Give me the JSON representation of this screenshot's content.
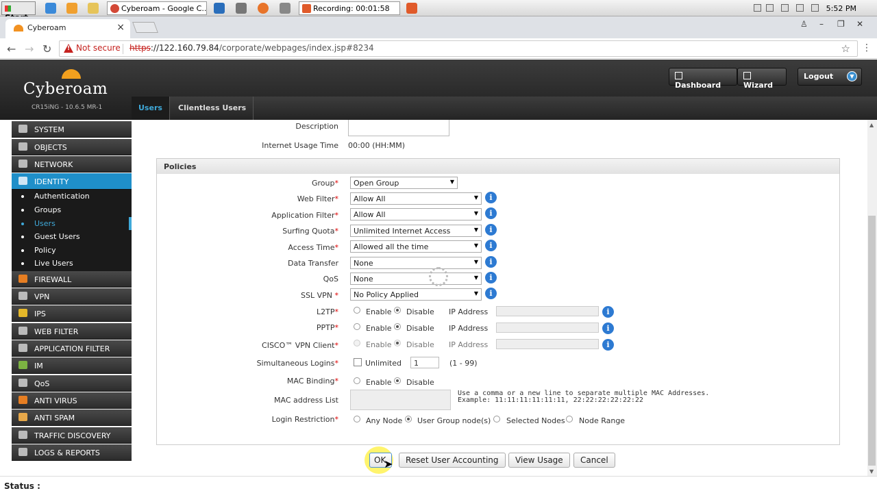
{
  "taskbar": {
    "start": "Start",
    "tasks": [
      "Cyberoam - Google C...",
      "Recording: 00:01:58"
    ],
    "clock": "5:52 PM"
  },
  "browser": {
    "tab_title": "Cyberoam",
    "not_secure": "Not secure",
    "url_scheme": "https",
    "url_rest": "://122.160.79.84",
    "url_path": "/corporate/webpages/index.jsp#8234"
  },
  "header": {
    "logo": "Cyberoam",
    "version": "CR15iNG - 10.6.5 MR-1",
    "dashboard": "Dashboard",
    "wizard": "Wizard",
    "logout": "Logout",
    "tabs": [
      "Users",
      "Clientless Users"
    ]
  },
  "sidebar": {
    "top_items": [
      "SYSTEM",
      "OBJECTS",
      "NETWORK",
      "IDENTITY"
    ],
    "sub_items": [
      "Authentication",
      "Groups",
      "Users",
      "Guest Users",
      "Policy",
      "Live Users"
    ],
    "bottom_items": [
      "FIREWALL",
      "VPN",
      "IPS",
      "WEB FILTER",
      "APPLICATION FILTER",
      "IM",
      "QoS",
      "ANTI VIRUS",
      "ANTI SPAM",
      "TRAFFIC DISCOVERY",
      "LOGS & REPORTS"
    ]
  },
  "form": {
    "description_label": "Description",
    "usage_time_label": "Internet Usage Time",
    "usage_time_value": "00:00 (HH:MM)",
    "policies_title": "Policies",
    "group_label": "Group",
    "group_value": "Open Group",
    "webfilter_label": "Web Filter",
    "webfilter_value": "Allow All",
    "appfilter_label": "Application Filter",
    "appfilter_value": "Allow All",
    "quota_label": "Surfing Quota",
    "quota_value": "Unlimited Internet Access",
    "access_label": "Access Time",
    "access_value": "Allowed all the time",
    "transfer_label": "Data Transfer",
    "transfer_value": "None",
    "qos_label": "QoS",
    "qos_value": "None",
    "sslvpn_label": "SSL VPN",
    "sslvpn_value": "No Policy Applied",
    "l2tp_label": "L2TP",
    "pptp_label": "PPTP",
    "cisco_label": "CISCO™ VPN Client",
    "enable": "Enable",
    "disable": "Disable",
    "ip_address": "IP Address",
    "logins_label": "Simultaneous Logins",
    "unlimited": "Unlimited",
    "logins_value": "1",
    "logins_range": "(1 - 99)",
    "mac_binding_label": "MAC Binding",
    "mac_list_label": "MAC address List",
    "mac_help1": "Use a comma or a new line to separate multiple MAC Addresses.",
    "mac_help2": "Example: 11:11:11:11:11:11, 22:22:22:22:22:22",
    "login_restriction_label": "Login Restriction",
    "any_node": "Any Node",
    "user_group_nodes": "User Group node(s)",
    "selected_nodes": "Selected Nodes",
    "node_range": "Node Range"
  },
  "buttons": {
    "ok": "OK",
    "reset": "Reset User Accounting",
    "view_usage": "View Usage",
    "cancel": "Cancel"
  },
  "status": "Status :"
}
